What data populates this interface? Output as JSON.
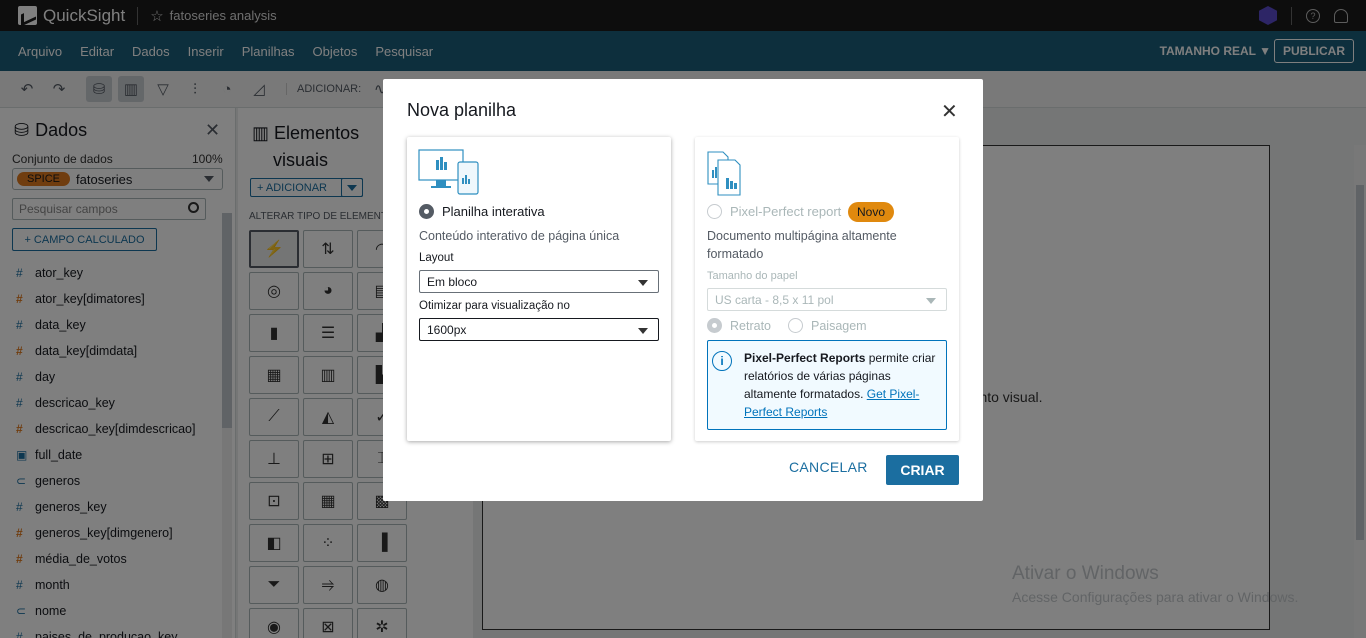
{
  "app": {
    "name": "QuickSight",
    "analysis_name": "fatoseries analysis"
  },
  "menu": {
    "items": [
      "Arquivo",
      "Editar",
      "Dados",
      "Inserir",
      "Planilhas",
      "Objetos",
      "Pesquisar"
    ],
    "size_label": "TAMANHO REAL",
    "publish_label": "PUBLICAR"
  },
  "toolbar": {
    "add_label": "ADICIONAR:"
  },
  "data_panel": {
    "title": "Dados",
    "dataset_label": "Conjunto de dados",
    "dataset_pct": "100%",
    "spice_label": "SPICE",
    "dataset_name": "fatoseries",
    "search_placeholder": "Pesquisar campos",
    "calc_field_label": "+ CAMPO CALCULADO",
    "fields": [
      {
        "type": "#",
        "name": "ator_key",
        "color": "blue"
      },
      {
        "type": "#",
        "name": "ator_key[dimatores]",
        "color": "orange"
      },
      {
        "type": "#",
        "name": "data_key",
        "color": "blue"
      },
      {
        "type": "#",
        "name": "data_key[dimdata]",
        "color": "orange"
      },
      {
        "type": "#",
        "name": "day",
        "color": "blue"
      },
      {
        "type": "#",
        "name": "descricao_key",
        "color": "blue"
      },
      {
        "type": "#",
        "name": "descricao_key[dimdescricao]",
        "color": "orange"
      },
      {
        "type": "date",
        "name": "full_date",
        "color": "blue"
      },
      {
        "type": "text",
        "name": "generos",
        "color": "blue"
      },
      {
        "type": "#",
        "name": "generos_key",
        "color": "blue"
      },
      {
        "type": "#",
        "name": "generos_key[dimgenero]",
        "color": "orange"
      },
      {
        "type": "#",
        "name": "média_de_votos",
        "color": "orange"
      },
      {
        "type": "#",
        "name": "month",
        "color": "blue"
      },
      {
        "type": "text",
        "name": "nome",
        "color": "blue"
      },
      {
        "type": "#",
        "name": "paises_de_producao_key",
        "color": "blue"
      }
    ]
  },
  "visuals_panel": {
    "title_line1": "Elementos",
    "title_line2": "visuais",
    "add_label": "+ ADICIONAR",
    "change_type_label": "ALTERAR TIPO DE ELEMENT"
  },
  "canvas": {
    "hint": "mento visual."
  },
  "watermark": {
    "line1": "Ativar o Windows",
    "line2": "Acesse Configurações para ativar o Windows."
  },
  "modal": {
    "title": "Nova planilha",
    "interactive": {
      "title": "Planilha interativa",
      "desc": "Conteúdo interativo de página única",
      "layout_label": "Layout",
      "layout_value": "Em bloco",
      "optimize_label": "Otimizar para visualização no",
      "optimize_value": "1600px"
    },
    "pixel": {
      "title": "Pixel-Perfect report",
      "badge": "Novo",
      "desc": "Documento multipágina altamente formatado",
      "paper_label": "Tamanho do papel",
      "paper_value": "US carta - 8,5 x 11 pol",
      "portrait": "Retrato",
      "landscape": "Paisagem",
      "info_bold": "Pixel-Perfect Reports",
      "info_text": " permite criar relatórios de várias páginas altamente formatados. ",
      "info_link": "Get Pixel-Perfect Reports"
    },
    "cancel_label": "CANCELAR",
    "create_label": "CRIAR"
  }
}
